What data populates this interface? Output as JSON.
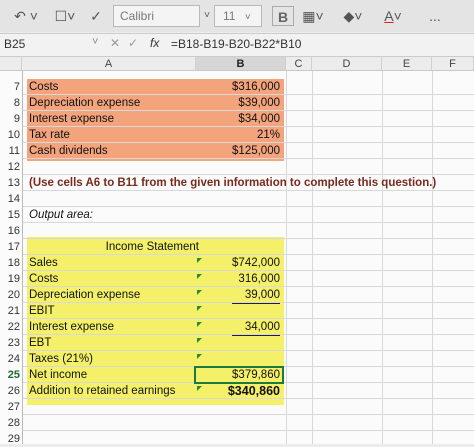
{
  "toolbar": {
    "font_name": "Calibri",
    "font_size": "11",
    "bold_label": "B",
    "font_color_label": "A",
    "more_label": "..."
  },
  "formula_bar": {
    "name_box": "B25",
    "fx": "fx",
    "formula": "=B18-B19-B20-B22*B10"
  },
  "columns": [
    "A",
    "B",
    "C",
    "D",
    "E",
    "F"
  ],
  "rows": [
    "7",
    "8",
    "9",
    "10",
    "11",
    "12",
    "13",
    "14",
    "15",
    "16",
    "17",
    "18",
    "19",
    "20",
    "21",
    "22",
    "23",
    "24",
    "25",
    "26",
    "27",
    "28",
    "29"
  ],
  "given": [
    {
      "label": "Costs",
      "value": "$316,000"
    },
    {
      "label": "Depreciation expense",
      "value": "$39,000"
    },
    {
      "label": "Interest expense",
      "value": "$34,000"
    },
    {
      "label": "Tax rate",
      "value": "21%"
    },
    {
      "label": "Cash dividends",
      "value": "$125,000"
    }
  ],
  "instruction": "(Use cells A6 to B11 from the given information to complete this question.)",
  "output_label": "Output area:",
  "statement": {
    "title": "Income Statement",
    "rows": [
      {
        "label": "Sales",
        "value": "$742,000"
      },
      {
        "label": "Costs",
        "value": "316,000"
      },
      {
        "label": "Depreciation expense",
        "value": "39,000"
      },
      {
        "label": "EBIT",
        "value": ""
      },
      {
        "label": "Interest expense",
        "value": "34,000"
      },
      {
        "label": "EBT",
        "value": ""
      },
      {
        "label": "Taxes (21%)",
        "value": ""
      },
      {
        "label": "Net income",
        "value": "$379,860"
      },
      {
        "label": "Addition to retained earnings",
        "value": "$340,860"
      }
    ]
  }
}
